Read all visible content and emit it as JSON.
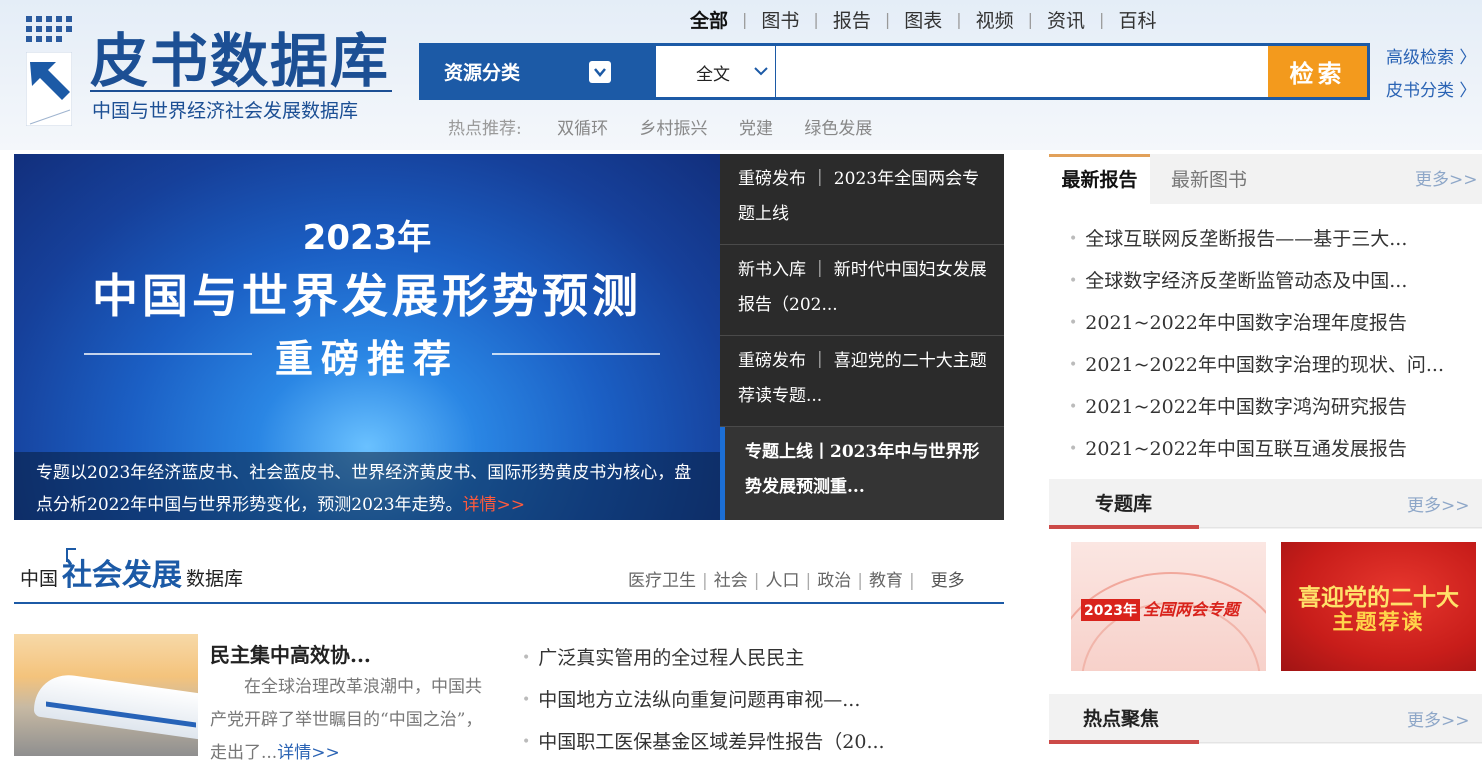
{
  "header": {
    "logo_title": "皮书数据库",
    "logo_subtitle": "中国与世界经济社会发展数据库",
    "nav": [
      "全部",
      "图书",
      "报告",
      "图表",
      "视频",
      "资讯",
      "百科"
    ],
    "search": {
      "category_label": "资源分类",
      "scope_value": "全文",
      "query_value": "",
      "button_label": "检索"
    },
    "side_links": [
      "高级检索 〉",
      "皮书分类 〉"
    ],
    "hot": {
      "label": "热点推荐:",
      "keywords": [
        "双循环",
        "乡村振兴",
        "党建",
        "绿色发展"
      ]
    }
  },
  "banner": {
    "year": "2023年",
    "title": "中国与世界发展形势预测",
    "subtitle": "重磅推荐",
    "caption": "专题以2023年经济蓝皮书、社会蓝皮书、世界经济黄皮书、国际形势黄皮书为核心，盘点分析2022年中国与世界形势变化，预测2023年走势。",
    "caption_more": "详情>>",
    "list": [
      "重磅发布 ｜ 2023年全国两会专题上线",
      "新书入库 ｜ 新时代中国妇女发展报告（202...",
      "重磅发布 ｜ 喜迎党的二十大主题荐读专题...",
      "专题上线丨2023年中与世界形势发展预测重..."
    ]
  },
  "social": {
    "title_pre": "中国",
    "title_main": "社会发展",
    "title_post": "数据库",
    "tabs": [
      "医疗卫生",
      "社会",
      "人口",
      "政治",
      "教育"
    ],
    "more": "更多",
    "featured_title": "民主集中高效协...",
    "featured_desc": "在全球治理改革浪潮中，中国共产党开辟了举世瞩目的“中国之治”，走出了...",
    "featured_more": "详情>>",
    "items": [
      "广泛真实管用的全过程人民民主",
      "中国地方立法纵向重复问题再审视—...",
      "中国职工医保基金区域差异性报告（20..."
    ]
  },
  "right": {
    "tabs": [
      "最新报告",
      "最新图书"
    ],
    "more": "更多>>",
    "reports": [
      "全球互联网反垄断报告——基于三大...",
      "全球数字经济反垄断监管动态及中国...",
      "2021~2022年中国数字治理年度报告",
      "2021~2022年中国数字治理的现状、问...",
      "2021~2022年中国数字鸿沟研究报告",
      "2021~2022年中国互联互通发展报告"
    ],
    "topic_title": "专题库",
    "topic_more": "更多>>",
    "topic1_year": "2023年",
    "topic1_name": "全国两会专题",
    "topic2_line1": "喜迎党的二十大",
    "topic2_line2": "主题荐读",
    "focus_title": "热点聚焦",
    "focus_more": "更多>>"
  },
  "colors": {
    "brand_blue": "#1c5aa6",
    "search_orange": "#f39a1d",
    "accent_red": "#cc4a48"
  }
}
